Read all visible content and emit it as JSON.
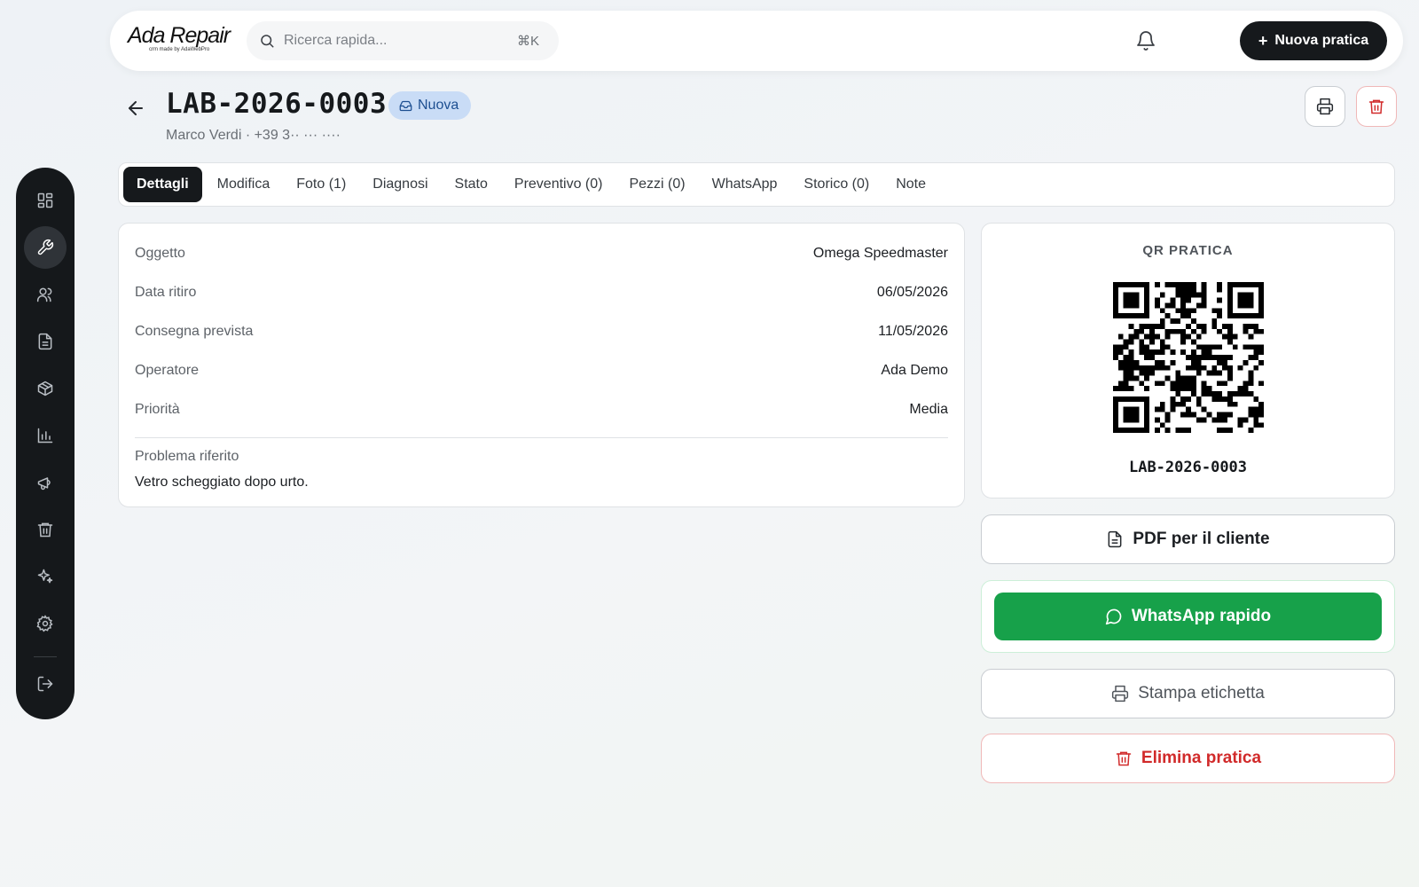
{
  "app": {
    "logo_text": "Ada Repair",
    "logo_subtitle": "crm made by AdaWebPro"
  },
  "search": {
    "placeholder": "Ricerca rapida...",
    "shortcut": "⌘K"
  },
  "header_actions": {
    "new_case_label": "Nuova pratica"
  },
  "sidebar": {
    "items": [
      {
        "icon": "dashboard-icon",
        "active": false
      },
      {
        "icon": "wrench-icon",
        "active": true
      },
      {
        "icon": "users-icon",
        "active": false
      },
      {
        "icon": "document-icon",
        "active": false
      },
      {
        "icon": "package-icon",
        "active": false
      },
      {
        "icon": "bar-chart-icon",
        "active": false
      },
      {
        "icon": "megaphone-icon",
        "active": false
      },
      {
        "icon": "trash-icon",
        "active": false
      },
      {
        "icon": "sparkles-icon",
        "active": false
      },
      {
        "icon": "settings-icon",
        "active": false
      },
      {
        "icon": "logout-icon",
        "active": false
      }
    ]
  },
  "case": {
    "code": "LAB-2026-0003",
    "status": "Nuova",
    "customer_line": "Marco Verdi · +39 3·· ··· ····"
  },
  "tabs": [
    {
      "label": "Dettagli",
      "active": true
    },
    {
      "label": "Modifica",
      "active": false
    },
    {
      "label": "Foto (1)",
      "active": false
    },
    {
      "label": "Diagnosi",
      "active": false
    },
    {
      "label": "Stato",
      "active": false
    },
    {
      "label": "Preventivo (0)",
      "active": false
    },
    {
      "label": "Pezzi (0)",
      "active": false
    },
    {
      "label": "WhatsApp",
      "active": false
    },
    {
      "label": "Storico (0)",
      "active": false
    },
    {
      "label": "Note",
      "active": false
    }
  ],
  "details": {
    "rows": [
      {
        "label": "Oggetto",
        "value": "Omega Speedmaster"
      },
      {
        "label": "Data ritiro",
        "value": "06/05/2026"
      },
      {
        "label": "Consegna prevista",
        "value": "11/05/2026"
      },
      {
        "label": "Operatore",
        "value": "Ada Demo"
      },
      {
        "label": "Priorità",
        "value": "Media"
      }
    ],
    "problem_label": "Problema riferito",
    "problem_text": "Vetro scheggiato dopo urto."
  },
  "qr": {
    "title": "QR PRATICA",
    "caption": "LAB-2026-0003"
  },
  "actions": {
    "pdf_label": "PDF per il cliente",
    "whatsapp_label": "WhatsApp rapido",
    "print_label": "Stampa etichetta",
    "delete_label": "Elimina pratica"
  },
  "colors": {
    "accent_dark": "#16191c",
    "whatsapp_green": "#17a14a",
    "danger_red": "#d12a2a",
    "status_badge_bg": "#c9dcf6"
  }
}
